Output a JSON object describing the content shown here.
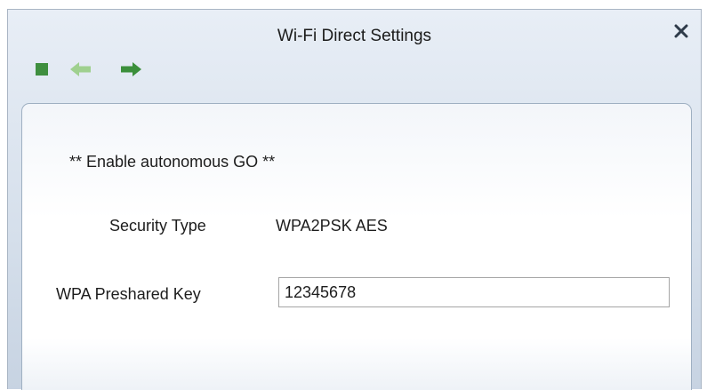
{
  "window": {
    "title": "Wi-Fi Direct Settings"
  },
  "toolbar": {
    "buttons": [
      {
        "icon": "stop-square-icon",
        "color": "#3f8f3f"
      },
      {
        "icon": "arrow-left-icon",
        "color": "#9fd08f",
        "state": "disabled"
      },
      {
        "icon": "arrow-right-icon",
        "color": "#3b8f3b"
      }
    ]
  },
  "close_icon": "close-icon",
  "panel": {
    "heading": "** Enable autonomous GO **",
    "security_type_label": "Security Type",
    "security_type_value": "WPA2PSK AES",
    "preshared_key_label": "WPA Preshared Key",
    "preshared_key_value": "12345678"
  },
  "colors": {
    "title_bar_top": "#e8eef6",
    "title_bar_bottom": "#c7d3e2",
    "panel_border": "#9fb0c2",
    "accent_green": "#3f8f3f"
  }
}
